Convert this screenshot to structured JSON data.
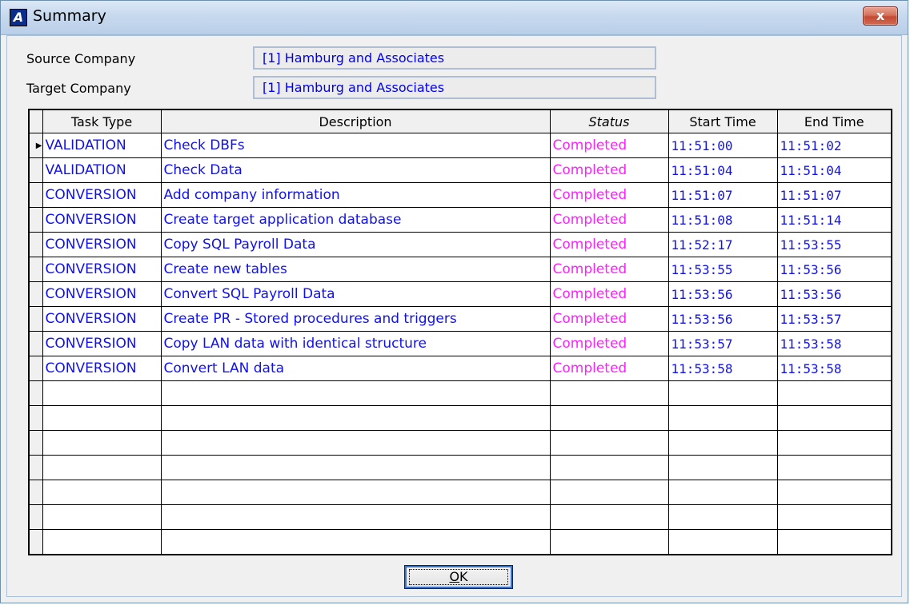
{
  "window": {
    "title": "Summary",
    "app_icon_letter": "A",
    "close_glyph": "x"
  },
  "form": {
    "source_label": "Source Company",
    "source_value": "[1] Hamburg and Associates",
    "target_label": "Target Company",
    "target_value": "[1] Hamburg and Associates"
  },
  "grid": {
    "columns": [
      "Task Type",
      "Description",
      "Status",
      "Start Time",
      "End Time"
    ],
    "current_row_indicator": "▶",
    "rows": [
      [
        "VALIDATION",
        "Check DBFs",
        "Completed",
        "11:51:00",
        "11:51:02"
      ],
      [
        "VALIDATION",
        "Check Data",
        "Completed",
        "11:51:04",
        "11:51:04"
      ],
      [
        "CONVERSION",
        "Add company information",
        "Completed",
        "11:51:07",
        "11:51:07"
      ],
      [
        "CONVERSION",
        "Create target application database",
        "Completed",
        "11:51:08",
        "11:51:14"
      ],
      [
        "CONVERSION",
        "Copy SQL Payroll Data",
        "Completed",
        "11:52:17",
        "11:53:55"
      ],
      [
        "CONVERSION",
        "Create new tables",
        "Completed",
        "11:53:55",
        "11:53:56"
      ],
      [
        "CONVERSION",
        "Convert SQL Payroll Data",
        "Completed",
        "11:53:56",
        "11:53:56"
      ],
      [
        "CONVERSION",
        "Create PR - Stored procedures and triggers",
        "Completed",
        "11:53:56",
        "11:53:57"
      ],
      [
        "CONVERSION",
        "Copy LAN data with identical structure",
        "Completed",
        "11:53:57",
        "11:53:58"
      ],
      [
        "CONVERSION",
        "Convert LAN data",
        "Completed",
        "11:53:58",
        "11:53:58"
      ]
    ]
  },
  "buttons": {
    "ok_label": "OK",
    "ok_mnemonic": "O",
    "ok_rest": "K"
  },
  "colors": {
    "task_text": "#1111ee",
    "status_text": "#ff22ff",
    "time_text": "#1111ee"
  }
}
